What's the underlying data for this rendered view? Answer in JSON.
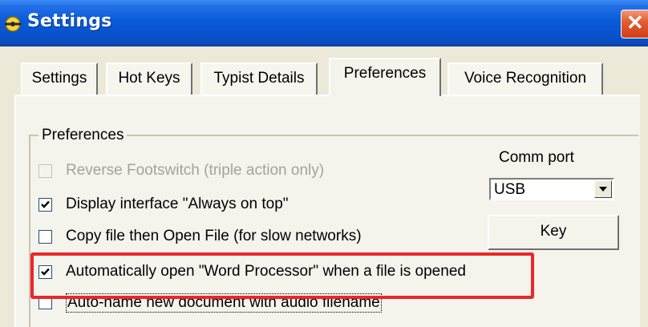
{
  "window": {
    "title": "Settings",
    "icon": "app-icon",
    "close_glyph": "✕"
  },
  "tabs": [
    {
      "label": "Settings",
      "active": false
    },
    {
      "label": "Hot Keys",
      "active": false
    },
    {
      "label": "Typist Details",
      "active": false
    },
    {
      "label": "Preferences",
      "active": true
    },
    {
      "label": "Voice Recognition",
      "active": false
    }
  ],
  "preferences": {
    "group_label": "Preferences",
    "options": [
      {
        "label": "Reverse Footswitch (triple action only)",
        "checked": false,
        "enabled": false
      },
      {
        "label": "Display interface \"Always on top\"",
        "checked": true,
        "enabled": true
      },
      {
        "label": "Copy file then Open File (for slow networks)",
        "checked": false,
        "enabled": true
      },
      {
        "label": "Automatically open \"Word Processor\"  when a file is opened",
        "checked": true,
        "enabled": true,
        "highlighted": true
      },
      {
        "label": "Auto-name new document with audio filename",
        "checked": false,
        "enabled": true,
        "focused": true
      }
    ]
  },
  "comm_port": {
    "label": "Comm port",
    "value": "USB"
  },
  "key_button": {
    "label": "Key"
  },
  "colors": {
    "title_bar": "#0854cf",
    "highlight": "#e8282a",
    "dialog_bg": "#ece9d8"
  }
}
